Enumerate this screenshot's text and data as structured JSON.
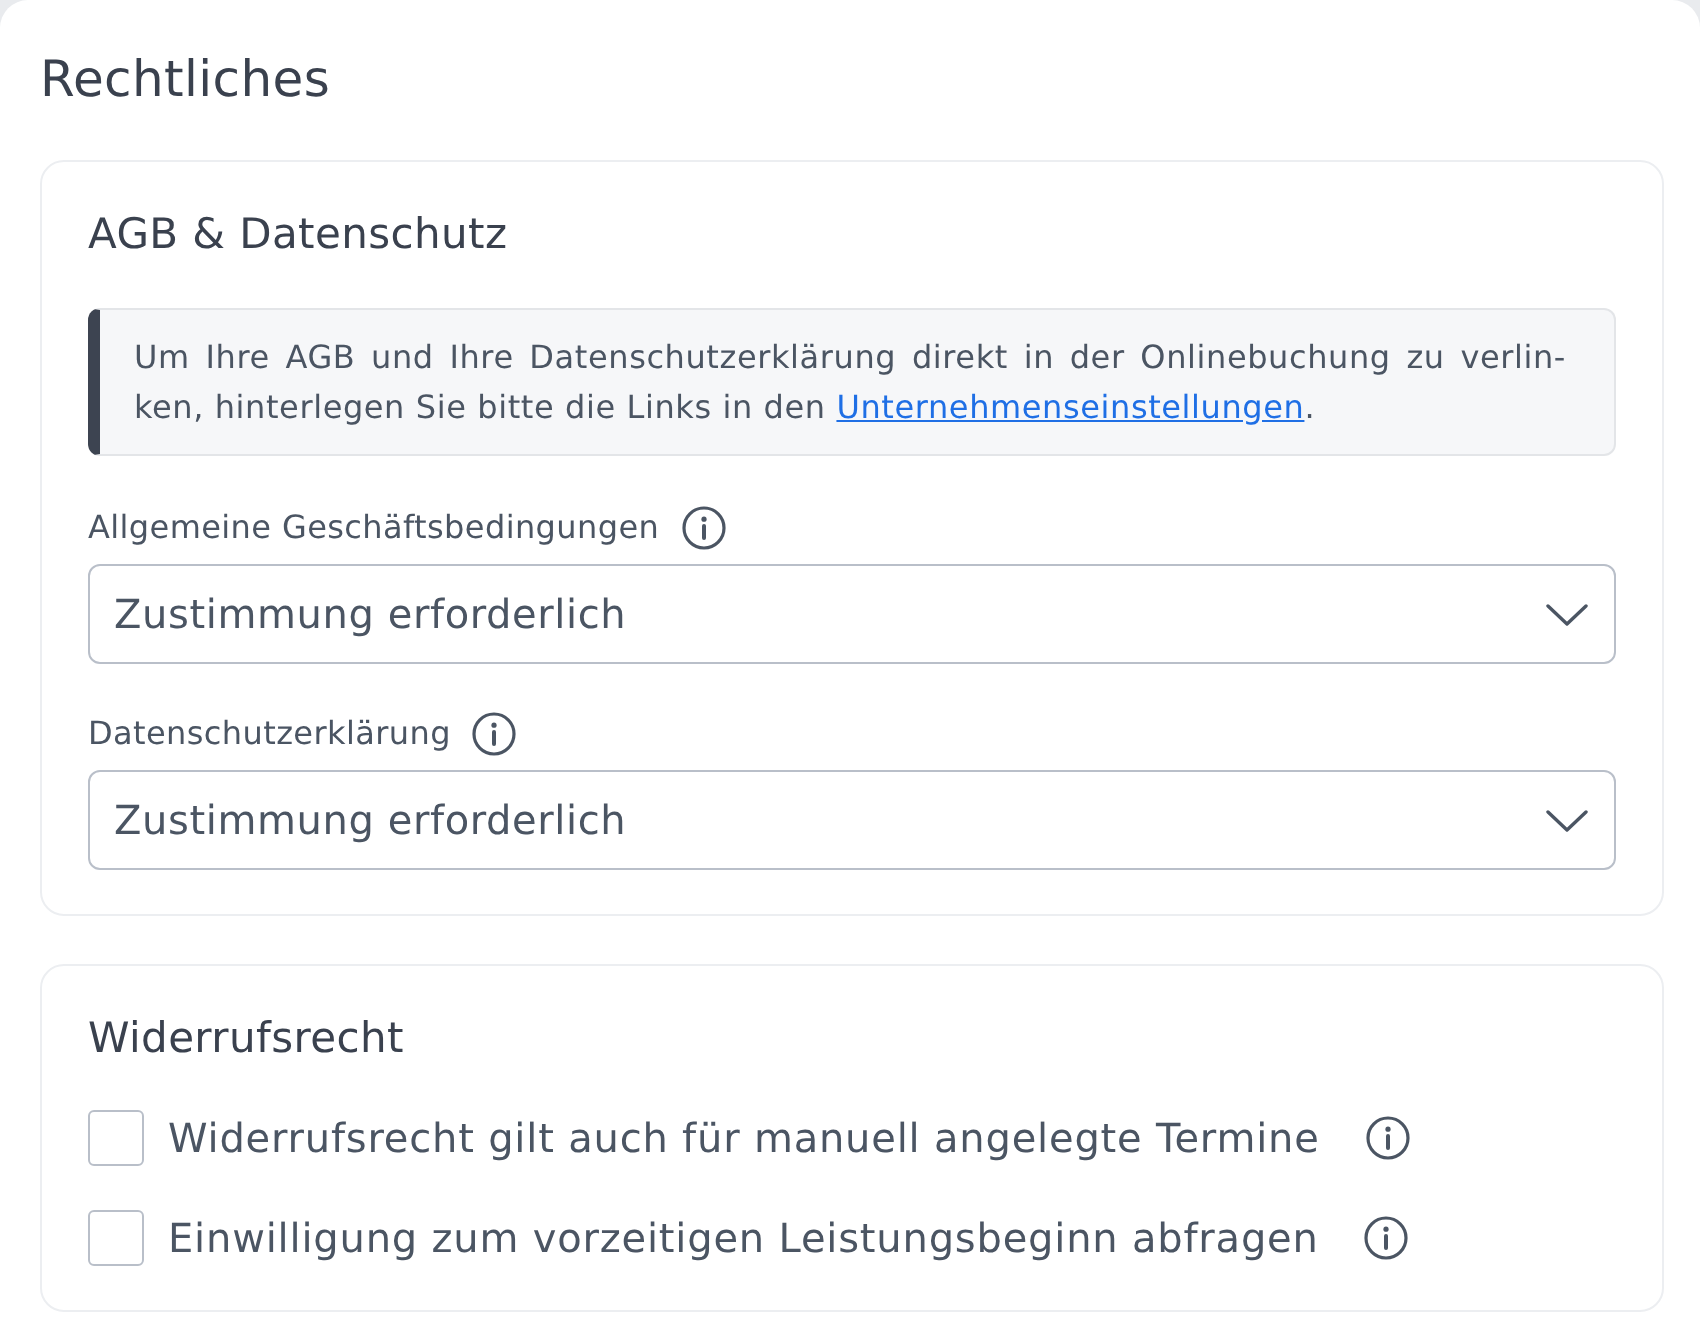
{
  "title": "Rechtliches",
  "sections": [
    {
      "kind": "selects",
      "heading": "AGB & Datenschutz",
      "notice": {
        "text": "Um Ihre AGB und Ihre Datenschutzerklärung direkt in der Onlinebuchung zu verlin-ken, hinterlegen Sie bitte die Links in den ",
        "link": "Unternehmenseinstellungen",
        "after": "."
      },
      "fields": [
        {
          "label": "Allgemeine Geschäftsbedingungen",
          "value": "Zustimmung erforderlich"
        },
        {
          "label": "Datenschutzerklärung",
          "value": "Zustimmung erforderlich"
        }
      ]
    },
    {
      "kind": "checkboxes",
      "heading": "Widerrufsrecht",
      "options": [
        {
          "label": "Widerrufsrecht gilt auch für manuell angelegte Termine",
          "checked": false
        },
        {
          "label": "Einwilligung zum vorzeitigen Leistungsbeginn abfragen",
          "checked": false
        }
      ]
    }
  ]
}
